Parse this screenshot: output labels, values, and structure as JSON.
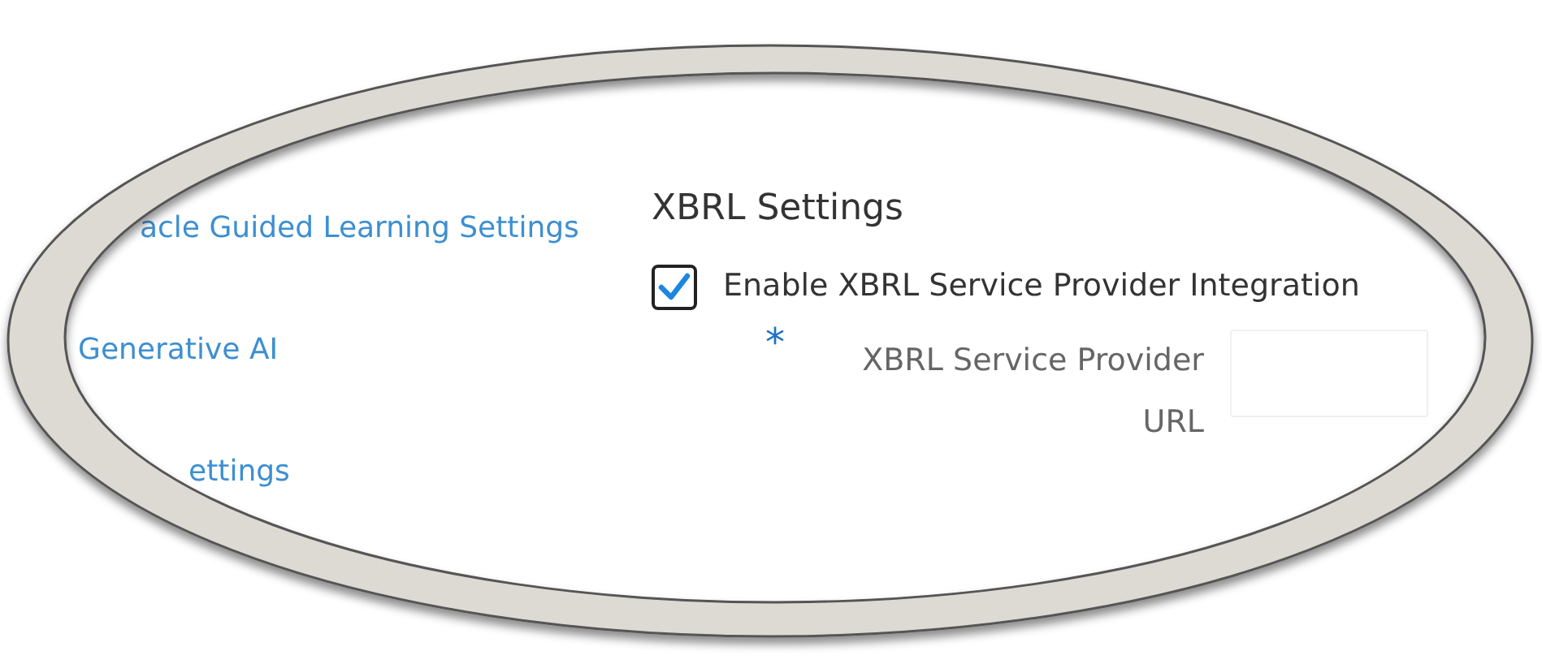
{
  "sidebar": {
    "items": [
      {
        "label": "acle Guided Learning Settings"
      },
      {
        "label": "Generative AI"
      },
      {
        "label": "ettings"
      }
    ]
  },
  "section": {
    "title": "XBRL Settings",
    "checkbox": {
      "label": "Enable XBRL Service Provider Integration",
      "checked": true
    },
    "field": {
      "label": "XBRL Service Provider URL",
      "required": true,
      "mark": "*"
    }
  }
}
